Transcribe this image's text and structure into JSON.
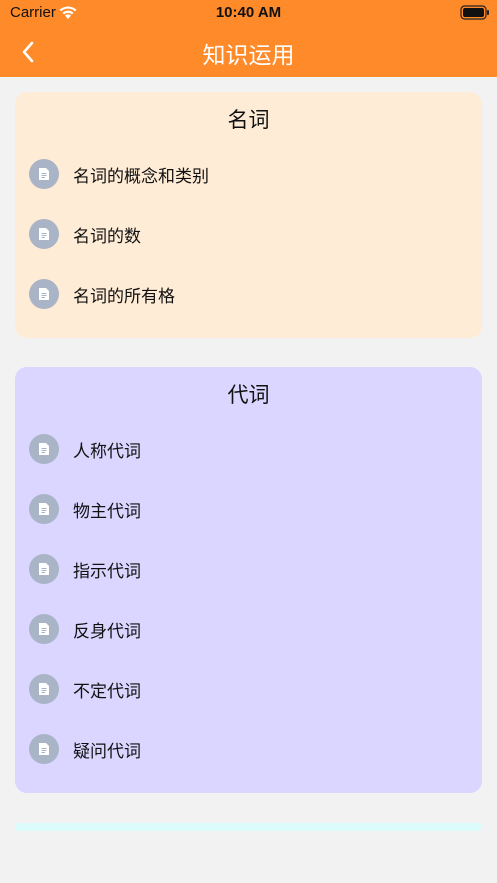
{
  "status_bar": {
    "carrier": "Carrier",
    "time": "10:40 AM"
  },
  "nav": {
    "title": "知识运用",
    "back_icon": "chevron-left-icon"
  },
  "colors": {
    "header": "#ff8a2a",
    "card_noun": "#ffecd6",
    "card_pronoun": "#dbd6ff",
    "icon_bg": "#a9b4c6"
  },
  "sections": [
    {
      "title": "名词",
      "items": [
        {
          "label": "名词的概念和类别",
          "icon": "document-icon"
        },
        {
          "label": "名词的数",
          "icon": "document-icon"
        },
        {
          "label": "名词的所有格",
          "icon": "document-icon"
        }
      ]
    },
    {
      "title": "代词",
      "items": [
        {
          "label": "人称代词",
          "icon": "document-icon"
        },
        {
          "label": "物主代词",
          "icon": "document-icon"
        },
        {
          "label": "指示代词",
          "icon": "document-icon"
        },
        {
          "label": "反身代词",
          "icon": "document-icon"
        },
        {
          "label": "不定代词",
          "icon": "document-icon"
        },
        {
          "label": "疑问代词",
          "icon": "document-icon"
        }
      ]
    }
  ]
}
